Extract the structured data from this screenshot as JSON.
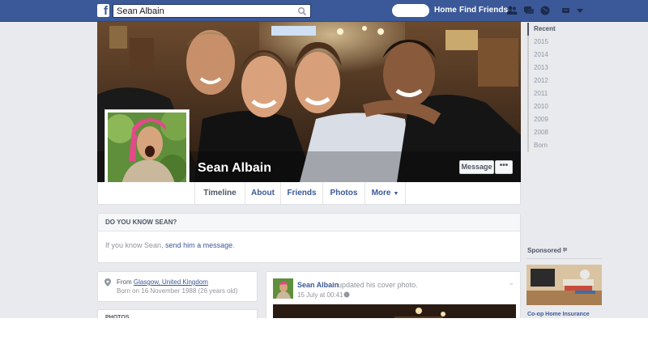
{
  "header": {
    "logo": "f",
    "search_value": "Sean Albain",
    "nav": {
      "home": "Home",
      "find_friends": "Find Friends"
    }
  },
  "profile": {
    "name": "Sean Albain",
    "message_label": "Message",
    "more_label": "•••"
  },
  "tabs": [
    {
      "label": "Timeline"
    },
    {
      "label": "About"
    },
    {
      "label": "Friends"
    },
    {
      "label": "Photos"
    },
    {
      "label": "More"
    }
  ],
  "know_box": {
    "title": "DO YOU KNOW SEAN?",
    "text_prefix": "If you know Sean, ",
    "link": "send him a message",
    "text_suffix": "."
  },
  "intro": {
    "from_label": "From ",
    "from_value": "Glasgow, United Kingdom",
    "born": "Born on 16 November 1988 (26 years old)",
    "photos_label": "PHOTOS"
  },
  "post": {
    "author": "Sean Albain",
    "action": "updated his cover photo.",
    "time": "15 July at 00:41 ·"
  },
  "years": [
    "Recent",
    "2015",
    "2014",
    "2013",
    "2012",
    "2011",
    "2010",
    "2009",
    "2008",
    "Born"
  ],
  "sponsored": {
    "label": "Sponsored",
    "ad_title": "Co-op Home Insurance"
  },
  "colors": {
    "brand": "#3b5998",
    "background": "#e9eaed"
  }
}
